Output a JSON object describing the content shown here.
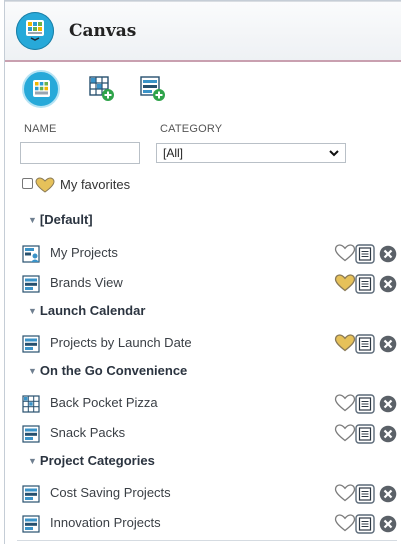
{
  "header": {
    "title": "Canvas"
  },
  "filters": {
    "name_label": "NAME",
    "name_value": "",
    "category_label": "CATEGORY",
    "category_value": "[All]",
    "favorites_label": "My favorites"
  },
  "groups": [
    {
      "title": "[Default]",
      "items": [
        {
          "label": "My Projects",
          "favorite": false
        },
        {
          "label": "Brands View",
          "favorite": true
        }
      ]
    },
    {
      "title": "Launch Calendar",
      "items": [
        {
          "label": "Projects by Launch Date",
          "favorite": true
        }
      ]
    },
    {
      "title": "On the Go Convenience",
      "items": [
        {
          "label": "Back Pocket Pizza",
          "favorite": false
        },
        {
          "label": "Snack Packs",
          "favorite": false
        }
      ]
    },
    {
      "title": "Project Categories",
      "items": [
        {
          "label": "Cost Saving Projects",
          "favorite": false
        },
        {
          "label": "Innovation Projects",
          "favorite": false
        }
      ]
    }
  ],
  "colors": {
    "accent": "#27a9d9",
    "favorite": "#e6c15a",
    "header_border": "#c9a0b0"
  },
  "icons": {
    "logo": "canvas-grid-icon",
    "favorite": "heart-icon",
    "details": "document-icon",
    "remove": "close-circle-icon"
  }
}
